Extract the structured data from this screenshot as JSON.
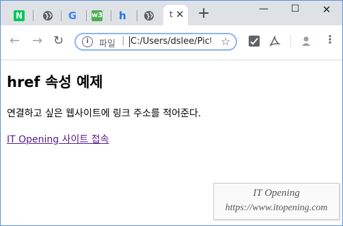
{
  "browser": {
    "tabs": [
      {
        "icon": "naver-n-icon",
        "label": "N"
      },
      {
        "icon": "globe-icon",
        "label": ""
      },
      {
        "icon": "google-g-icon",
        "label": "G"
      },
      {
        "icon": "w3schools-icon",
        "label": "w3"
      },
      {
        "icon": "h-site-icon",
        "label": "h"
      },
      {
        "icon": "globe-icon",
        "label": ""
      }
    ],
    "active_tab": {
      "title": "t",
      "close": "✕"
    },
    "new_tab": "+",
    "window_controls": {
      "minimize": "—",
      "maximize": "☐",
      "close": "✕"
    },
    "address": {
      "scheme_label": "파일",
      "separator": "|",
      "url": "C:/Users/dslee/Pictu"
    }
  },
  "page": {
    "heading": "href 속성 예제",
    "description": "연결하고 싶은 웹사이트에 링크 주소를 적어준다.",
    "link_text": "IT Opening 사이트 접속"
  },
  "watermark": {
    "line1": "IT Opening",
    "line2": "https://www.itopening.com"
  },
  "colors": {
    "tabstrip": "#dee1e6",
    "link_visited": "#551a8b",
    "omnibox_focus": "#8ab4f8"
  }
}
